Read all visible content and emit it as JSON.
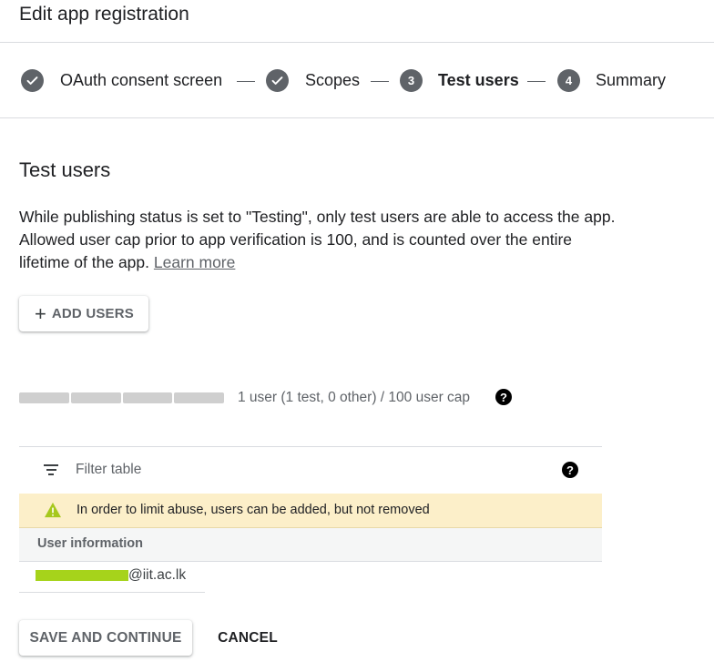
{
  "header": {
    "title": "Edit app registration"
  },
  "stepper": {
    "steps": [
      {
        "label": "OAuth consent screen",
        "state": "complete",
        "marker": "check-icon"
      },
      {
        "label": "Scopes",
        "state": "complete",
        "marker": "check-icon"
      },
      {
        "label": "Test users",
        "state": "active",
        "number": "3"
      },
      {
        "label": "Summary",
        "state": "pending",
        "number": "4"
      }
    ]
  },
  "section": {
    "title": "Test users",
    "description": "While publishing status is set to \"Testing\", only test users are able to access the app. Allowed user cap prior to app verification is 100, and is counted over the entire lifetime of the app.",
    "learn_more": "Learn more"
  },
  "add_users": {
    "icon": "plus-icon",
    "label": "ADD USERS"
  },
  "user_cap": {
    "text": "1 user (1 test, 0 other) / 100 user cap",
    "used": 1,
    "cap": 100,
    "help_icon": "help-icon"
  },
  "table": {
    "filter": {
      "icon": "filter-icon",
      "placeholder": "Filter table",
      "help_icon": "help-icon"
    },
    "warning": {
      "icon": "warning-icon",
      "text": "In order to limit abuse, users can be added, but not removed"
    },
    "column_header": "User information",
    "rows": [
      {
        "email_domain": "@iit.ac.lk",
        "redacted": true
      }
    ]
  },
  "actions": {
    "save": "SAVE AND CONTINUE",
    "cancel": "CANCEL"
  },
  "colors": {
    "step_circle": "#5f6368",
    "warning_bg": "#fcefc9",
    "warning_icon": "#a6c81d",
    "redaction": "#a6d31b",
    "divider": "#dadce0"
  }
}
